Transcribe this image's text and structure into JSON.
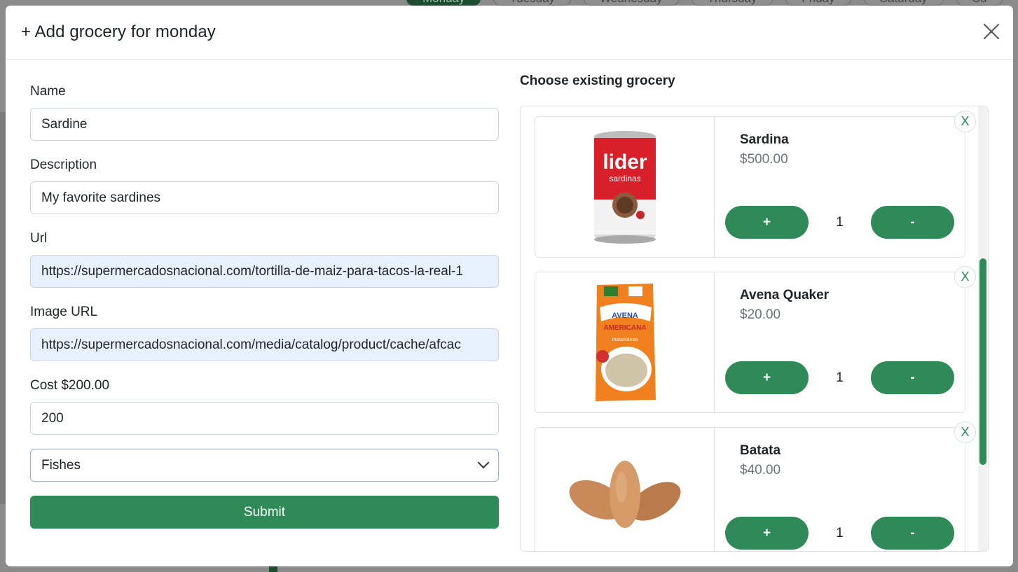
{
  "background": {
    "tabs": [
      {
        "label": "Monday",
        "active": true
      },
      {
        "label": "Tuesday",
        "active": false
      },
      {
        "label": "Wednesday",
        "active": false
      },
      {
        "label": "Thursday",
        "active": false
      },
      {
        "label": "Friday",
        "active": false
      },
      {
        "label": "Saturday",
        "active": false
      },
      {
        "label": "Su",
        "active": false
      }
    ]
  },
  "modal": {
    "title": "+ Add grocery for monday",
    "close_icon": "close-icon"
  },
  "form": {
    "name_label": "Name",
    "name_value": "Sardine",
    "description_label": "Description",
    "description_value": "My favorite sardines",
    "url_label": "Url",
    "url_value": "https://supermercadosnacional.com/tortilla-de-maiz-para-tacos-la-real-1",
    "image_url_label": "Image URL",
    "image_url_value": "https://supermercadosnacional.com/media/catalog/product/cache/afcac",
    "cost_label": "Cost $200.00",
    "cost_value": "200",
    "category_selected": "Fishes",
    "submit_label": "Submit"
  },
  "existing": {
    "title": "Choose existing grocery",
    "items": [
      {
        "name": "Sardina",
        "price": "$500.00",
        "qty": "1",
        "plus": "+",
        "minus": "-",
        "remove": "X",
        "image": "sardine-can-image"
      },
      {
        "name": "Avena Quaker",
        "price": "$20.00",
        "qty": "1",
        "plus": "+",
        "minus": "-",
        "remove": "X",
        "image": "oat-bag-image"
      },
      {
        "name": "Batata",
        "price": "$40.00",
        "qty": "1",
        "plus": "+",
        "minus": "-",
        "remove": "X",
        "image": "sweet-potato-image"
      }
    ]
  },
  "colors": {
    "accent": "#2e8b57",
    "autofill": "#e8f0fe"
  }
}
